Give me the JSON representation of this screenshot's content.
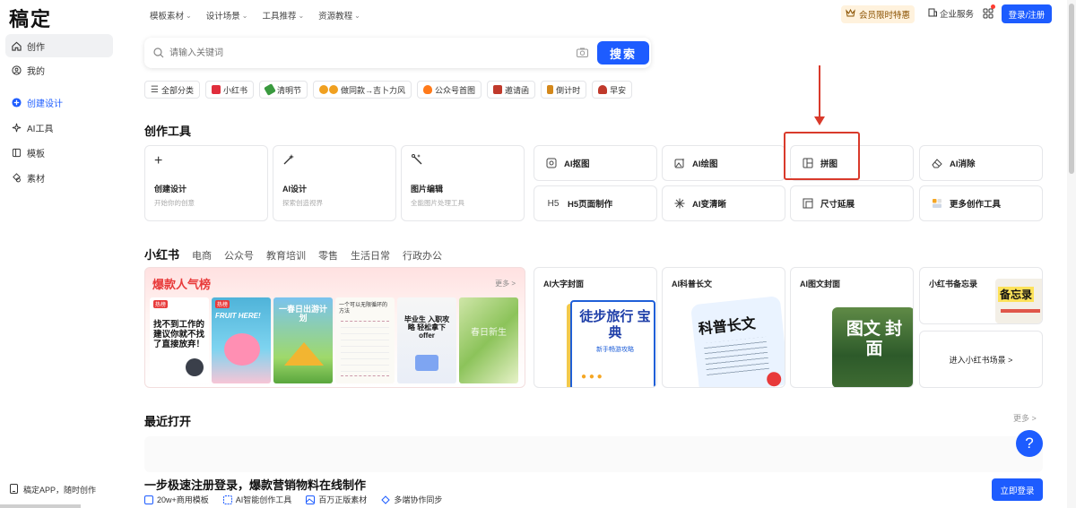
{
  "app": {
    "logo": "稿定"
  },
  "sidebar": {
    "items": [
      {
        "label": "创作",
        "icon": "home-icon"
      },
      {
        "label": "我的",
        "icon": "user-icon"
      },
      {
        "label": "创建设计",
        "icon": "plus-circle-icon"
      },
      {
        "label": "AI工具",
        "icon": "sparkle-icon"
      },
      {
        "label": "模板",
        "icon": "template-icon"
      },
      {
        "label": "素材",
        "icon": "shapes-icon"
      }
    ],
    "footer": "稿定APP，随时创作"
  },
  "topnav": {
    "items": [
      "模板素材",
      "设计场景",
      "工具推荐",
      "资源教程"
    ],
    "vip": "会员限时特惠",
    "enterprise": "企业服务",
    "login": "登录/注册"
  },
  "search": {
    "placeholder": "请输入关键词",
    "button": "搜索"
  },
  "chips": [
    {
      "label": "全部分类",
      "color": "#555555"
    },
    {
      "label": "小红书",
      "color": "#e02e3c"
    },
    {
      "label": "清明节",
      "color": "#3a9a3f"
    },
    {
      "label": "做同款→吉卜力风",
      "color": "#f0a020"
    },
    {
      "label": "公众号首图",
      "color": "#ff7a1a"
    },
    {
      "label": "邀请函",
      "color": "#c0392b"
    },
    {
      "label": "倒计时",
      "color": "#d4881b"
    },
    {
      "label": "早安",
      "color": "#c0392b"
    }
  ],
  "tools": {
    "title": "创作工具",
    "big": [
      {
        "title": "创建设计",
        "sub": "开始你的创意"
      },
      {
        "title": "AI设计",
        "sub": "探索创造视界"
      },
      {
        "title": "图片编辑",
        "sub": "全能图片处理工具"
      }
    ],
    "small": [
      "AI抠图",
      "AI绘图",
      "拼图",
      "AI消除",
      "H5页面制作",
      "AI变清晰",
      "尺寸延展",
      "更多创作工具"
    ],
    "h5_icon_text": "H5"
  },
  "categories": {
    "tabs": [
      "小红书",
      "电商",
      "公众号",
      "教育培训",
      "零售",
      "生活日常",
      "行政办公"
    ]
  },
  "hot": {
    "title": "爆款人气榜",
    "more": "更多 >",
    "thumbs": [
      {
        "text": "找不到工作的建议你就不找了直接放弃！",
        "tag": "热榜"
      },
      {
        "text": "FRUIT HERE!",
        "tag": "热榜"
      },
      {
        "text": "一春日出游计划",
        "tag": ""
      },
      {
        "text": "一个可以无限循环的方法",
        "tag": ""
      },
      {
        "text": "毕业生 入职攻略 轻松拿下offer",
        "tag": ""
      },
      {
        "text": "春日新生",
        "tag": ""
      }
    ]
  },
  "features": [
    {
      "title": "AI大字封面",
      "art": "徒步旅行 宝典",
      "art_sub": "新手畅游攻略"
    },
    {
      "title": "AI科普长文",
      "art": "科普长文",
      "art_sub": ""
    },
    {
      "title": "AI图文封面",
      "art": "图文 封面",
      "art_sub": ""
    }
  ],
  "memo": {
    "title": "小红书备忘录",
    "art": "备忘录",
    "enter": "进入小红书场景 >"
  },
  "recent": {
    "title": "最近打开",
    "more": "更多 >"
  },
  "banner": {
    "title": "一步极速注册登录，爆款营销物料在线制作",
    "features": [
      "20w+商用模板",
      "AI智能创作工具",
      "百万正版素材",
      "多端协作同步"
    ],
    "button": "立即登录"
  },
  "help": "?",
  "accent": "#1d5cff",
  "annotation_color": "#d93a2b"
}
